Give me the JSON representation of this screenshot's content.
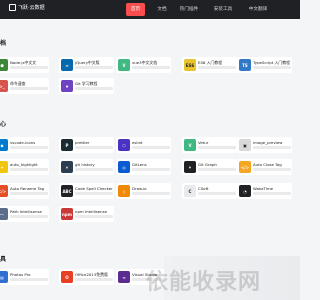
{
  "nav": {
    "brand": "飞跃·云数据",
    "tabs": [
      {
        "label": "首页",
        "active": true
      },
      {
        "label": "文档"
      },
      {
        "label": "热门插件"
      },
      {
        "label": "安装工具"
      },
      {
        "label": "中文翻译"
      }
    ]
  },
  "sections": [
    {
      "title": "档",
      "items": [
        {
          "title": "Node.js中文文",
          "icon": "node-icon",
          "color": "#3c873a",
          "glyph": "⬢"
        },
        {
          "title": "jQuery中文版",
          "icon": "jquery-icon",
          "color": "#0769ad",
          "glyph": "≈"
        },
        {
          "title": "vue3中文文档",
          "icon": "vue-icon",
          "color": "#41b883",
          "glyph": "V"
        },
        {
          "title": "ES6 入门教程",
          "icon": "es6-icon",
          "color": "#e8c32f",
          "glyph": "ES6"
        },
        {
          "title": "TypeScript 入门教程",
          "icon": "typescript-icon",
          "color": "#3178c6",
          "glyph": "TS"
        },
        {
          "title": "命令速查",
          "icon": "command-icon",
          "color": "#d9534f",
          "glyph": ">_"
        },
        {
          "title": "Git 学习教程",
          "icon": "git-icon",
          "color": "#6f42c1",
          "glyph": "♦"
        }
      ]
    },
    {
      "title": "心",
      "items": [
        {
          "title": "vscode-icons",
          "icon": "vscode-icons-icon",
          "color": "#007acc",
          "glyph": "◆"
        },
        {
          "title": "prettier",
          "icon": "prettier-icon",
          "color": "#1a2b34",
          "glyph": "P"
        },
        {
          "title": "eslint",
          "icon": "eslint-icon",
          "color": "#4b32c3",
          "glyph": "⬡"
        },
        {
          "title": "Vetur",
          "icon": "vetur-icon",
          "color": "#41b883",
          "glyph": "V"
        },
        {
          "title": "image_preview",
          "icon": "image-preview-icon",
          "color": "#d8d8d8",
          "glyph": "▣"
        },
        {
          "title": "auto_highlight",
          "icon": "highlight-icon",
          "color": "#f1c40f",
          "glyph": "✦"
        },
        {
          "title": "git history",
          "icon": "git-history-icon",
          "color": "#2c3e50",
          "glyph": "⑂"
        },
        {
          "title": "GitLens",
          "icon": "gitlens-icon",
          "color": "#0b5bd3",
          "glyph": "◎"
        },
        {
          "title": "Git Graph",
          "icon": "git-graph-icon",
          "color": "#1f2125",
          "glyph": "⑃"
        },
        {
          "title": "Auto Close Tag",
          "icon": "auto-close-tag-icon",
          "color": "#f5a623",
          "glyph": "</>"
        },
        {
          "title": "Auto Rename Tag",
          "icon": "auto-rename-tag-icon",
          "color": "#e44d26",
          "glyph": "</>"
        },
        {
          "title": "Code Spell Checker",
          "icon": "spell-checker-icon",
          "color": "#1f2125",
          "glyph": "ABC"
        },
        {
          "title": "Draw.io",
          "icon": "drawio-icon",
          "color": "#f08705",
          "glyph": "◇"
        },
        {
          "title": "CSoft",
          "icon": "csoft-icon",
          "color": "#e8eaee",
          "glyph": "C"
        },
        {
          "title": "WakaTime",
          "icon": "wakatime-icon",
          "color": "#1f2125",
          "glyph": "◔"
        },
        {
          "title": "Path Intellisense",
          "icon": "path-icon",
          "color": "#5b6b8a",
          "glyph": "⋯"
        },
        {
          "title": "npm Intellisense",
          "icon": "npm-icon",
          "color": "#cb3837",
          "glyph": "npm"
        }
      ]
    },
    {
      "title": "具",
      "items": [
        {
          "title": "Photos Pro",
          "icon": "photos-icon",
          "color": "#2f6fd1",
          "glyph": "▤"
        },
        {
          "title": "Office2013免费版",
          "icon": "office-icon",
          "color": "#ea3e23",
          "glyph": "O"
        },
        {
          "title": "Visual Studio",
          "icon": "visual-studio-icon",
          "color": "#5c2d91",
          "glyph": "∞"
        }
      ]
    }
  ],
  "watermark": "依能收录网"
}
